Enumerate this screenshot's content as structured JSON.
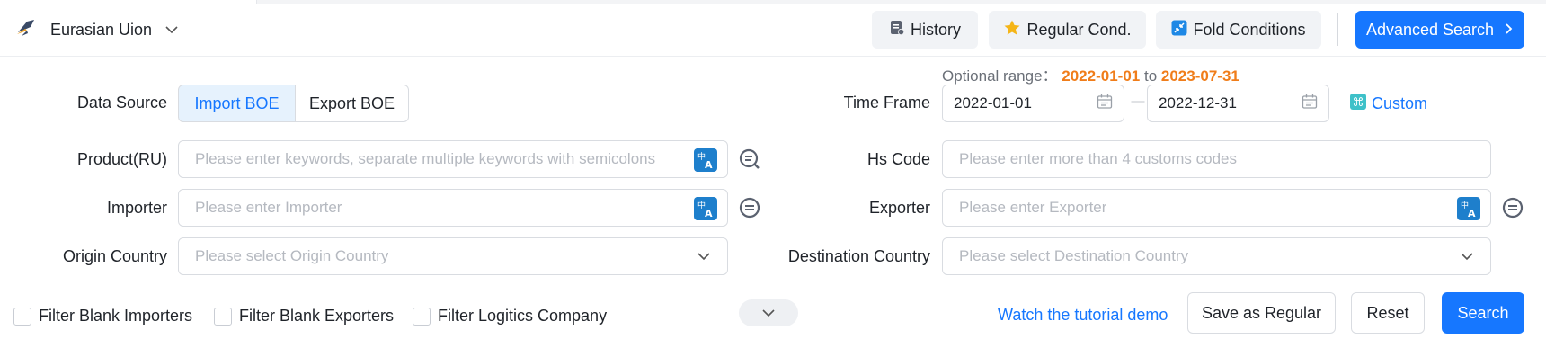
{
  "header": {
    "region": "Eurasian Uion",
    "buttons": {
      "history": "History",
      "regular": "Regular Cond.",
      "fold": "Fold Conditions",
      "advanced": "Advanced Search"
    }
  },
  "form": {
    "optional_range": {
      "prefix": "Optional range：",
      "start": "2022-01-01",
      "middle": "to",
      "end": "2023-07-31"
    },
    "data_source": {
      "label": "Data Source",
      "options": [
        "Import BOE",
        "Export BOE"
      ],
      "selected": "Import BOE"
    },
    "time_frame": {
      "label": "Time Frame",
      "start": "2022-01-01",
      "separator": "—",
      "end": "2022-12-31",
      "custom": "Custom"
    },
    "product": {
      "label": "Product(RU)",
      "placeholder": "Please enter keywords, separate multiple keywords with semicolons"
    },
    "hs_code": {
      "label": "Hs Code",
      "placeholder": "Please enter more than 4 customs codes"
    },
    "importer": {
      "label": "Importer",
      "placeholder": "Please enter Importer"
    },
    "exporter": {
      "label": "Exporter",
      "placeholder": "Please enter Exporter"
    },
    "origin": {
      "label": "Origin Country",
      "placeholder": "Please select Origin Country"
    },
    "destination": {
      "label": "Destination Country",
      "placeholder": "Please select Destination Country"
    }
  },
  "filters": [
    "Filter Blank Importers",
    "Filter Blank Exporters",
    "Filter Logitics Company"
  ],
  "actions": {
    "tutorial": "Watch the tutorial demo",
    "save": "Save as Regular",
    "reset": "Reset",
    "search": "Search"
  },
  "colors": {
    "primary": "#1677ff",
    "highlight": "#f07d1a",
    "translate_icon": "#1e7fcc"
  },
  "icons": [
    "logo-icon",
    "chevron-down-icon",
    "history-icon",
    "star-icon",
    "fold-icon",
    "chevron-right-icon",
    "calendar-icon",
    "custom-icon",
    "translate-icon",
    "keyword-search-icon"
  ]
}
